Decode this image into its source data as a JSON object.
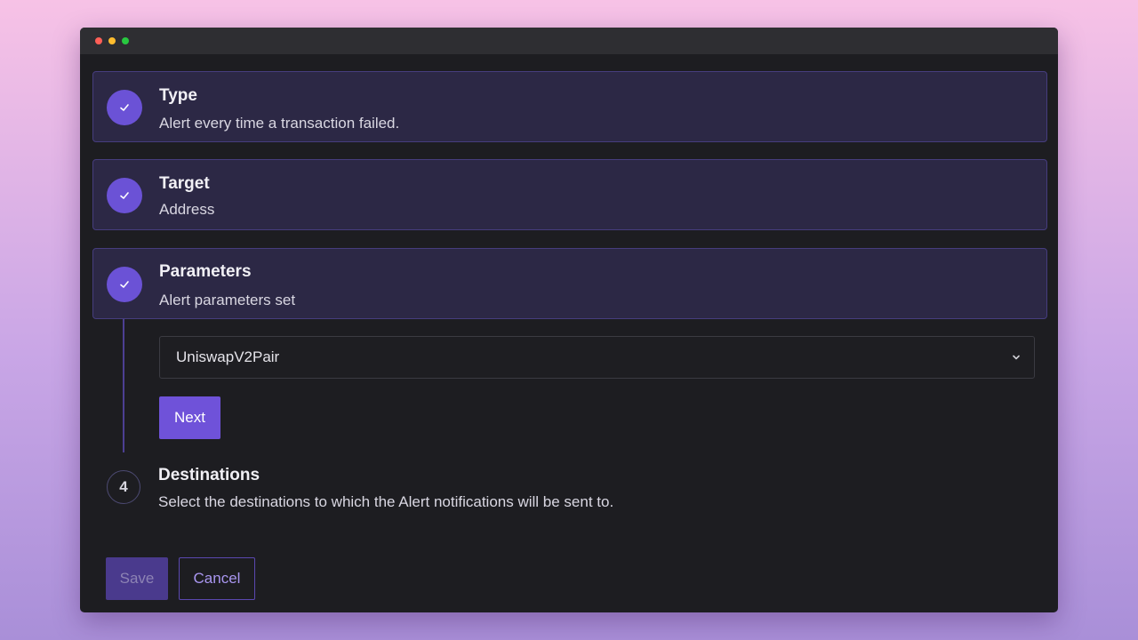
{
  "window_controls": [
    "close",
    "minimize",
    "maximize"
  ],
  "steps": [
    {
      "title": "Type",
      "description": "Alert every time a transaction failed.",
      "status": "completed",
      "icon": "check-icon"
    },
    {
      "title": "Target",
      "description": "Address",
      "status": "completed",
      "icon": "check-icon"
    },
    {
      "title": "Parameters",
      "description": "Alert parameters set",
      "status": "completed",
      "icon": "check-icon"
    },
    {
      "number": "4",
      "title": "Destinations",
      "description": "Select the destinations to which the Alert notifications will be sent to.",
      "status": "pending"
    }
  ],
  "parameters": {
    "contract_select_value": "UniswapV2Pair",
    "next_label": "Next"
  },
  "footer": {
    "save_label": "Save",
    "cancel_label": "Cancel"
  },
  "colors": {
    "accent": "#6f52d9",
    "card_bg": "#2c2845",
    "window_bg": "#1d1d21"
  }
}
